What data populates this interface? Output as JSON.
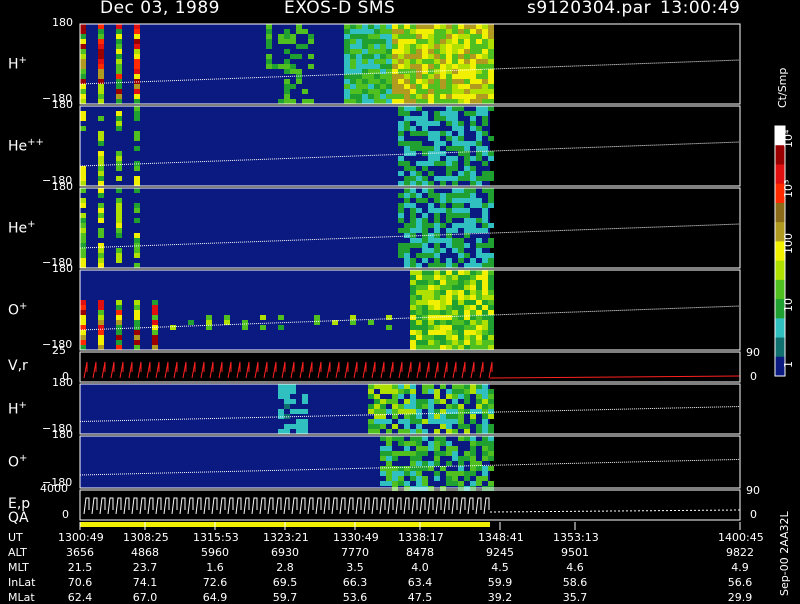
{
  "header": {
    "date": "Dec 03, 1989",
    "mission": "EXOS-D SMS",
    "file": "s9120304.par",
    "time": "13:00:49"
  },
  "panels": [
    {
      "label": "H",
      "sup": "+",
      "ymax": "180",
      "ymin": "−180"
    },
    {
      "label": "He",
      "sup": "++",
      "ymax": "180",
      "ymin": "−180"
    },
    {
      "label": "He",
      "sup": "+",
      "ymax": "180",
      "ymin": "−180"
    },
    {
      "label": "O",
      "sup": "+",
      "ymax": "180",
      "ymin": "−180"
    },
    {
      "label": "V,r",
      "sup": "",
      "ymax": "25",
      "ymin": "0",
      "rmax": "90",
      "rmin": "0"
    },
    {
      "label": "H",
      "sup": "+",
      "ymax": "180",
      "ymin": "−180"
    },
    {
      "label": "O",
      "sup": "+",
      "ymax": "180",
      "ymin": "−180"
    },
    {
      "label": "E,p",
      "sup": "",
      "ymax": "4000",
      "ymin": "0",
      "rmax": "90",
      "rmin": "0"
    }
  ],
  "qa_label": "QA",
  "colorbar": {
    "title": "Ct/Smp",
    "ticks": [
      "10",
      "1",
      "10",
      "100",
      "10",
      "10"
    ],
    "tick_labels": [
      "10⁴",
      "10³",
      "100",
      "10",
      "1"
    ],
    "colors": [
      "#ffffff",
      "#9b0000",
      "#e01010",
      "#ff2a00",
      "#8b6b1a",
      "#b09a20",
      "#f0f000",
      "#b0e000",
      "#50c020",
      "#20a030",
      "#30c0c0",
      "#107070",
      "#0a1a80"
    ]
  },
  "footer": {
    "rows": [
      {
        "name": "UT",
        "values": [
          "1300:49",
          "1308:25",
          "1315:53",
          "1323:21",
          "1330:49",
          "1338:17",
          "1348:41",
          "1353:13",
          "1400:45"
        ]
      },
      {
        "name": "ALT",
        "values": [
          "3656",
          "4868",
          "5960",
          "6930",
          "7770",
          "8478",
          "9245",
          "9501",
          "9822"
        ]
      },
      {
        "name": "MLT",
        "values": [
          "21.5",
          "23.7",
          "1.6",
          "2.8",
          "3.5",
          "4.0",
          "4.5",
          "4.6",
          "4.9"
        ]
      },
      {
        "name": "InLat",
        "values": [
          "70.6",
          "74.1",
          "72.6",
          "69.5",
          "66.3",
          "63.4",
          "59.9",
          "58.6",
          "56.6"
        ]
      },
      {
        "name": "MLat",
        "values": [
          "62.4",
          "67.0",
          "64.9",
          "59.7",
          "53.6",
          "47.5",
          "39.2",
          "35.7",
          "29.9"
        ]
      }
    ],
    "stamp": "Sep-00  2AA32L"
  },
  "chart_data": {
    "type": "heatmap",
    "title": "Dec 03, 1989   EXOS-D SMS",
    "xlabel": "UT",
    "x_ticks": [
      "1300:49",
      "1308:25",
      "1315:53",
      "1323:21",
      "1330:49",
      "1338:17",
      "1348:41",
      "1353:13",
      "1400:45"
    ],
    "series": [
      {
        "name": "H+",
        "ylim": [
          -180,
          180
        ]
      },
      {
        "name": "He++",
        "ylim": [
          -180,
          180
        ]
      },
      {
        "name": "He+",
        "ylim": [
          -180,
          180
        ]
      },
      {
        "name": "O+",
        "ylim": [
          -180,
          180
        ]
      },
      {
        "name": "V,r",
        "ylim": [
          0,
          25
        ]
      },
      {
        "name": "H+",
        "ylim": [
          -180,
          180
        ]
      },
      {
        "name": "O+",
        "ylim": [
          -180,
          180
        ]
      },
      {
        "name": "E,p",
        "ylim": [
          0,
          4000
        ]
      }
    ],
    "colorbar_unit": "Ct/Smp",
    "colorbar_range": [
      1,
      10000
    ],
    "colorbar_scale": "log"
  }
}
